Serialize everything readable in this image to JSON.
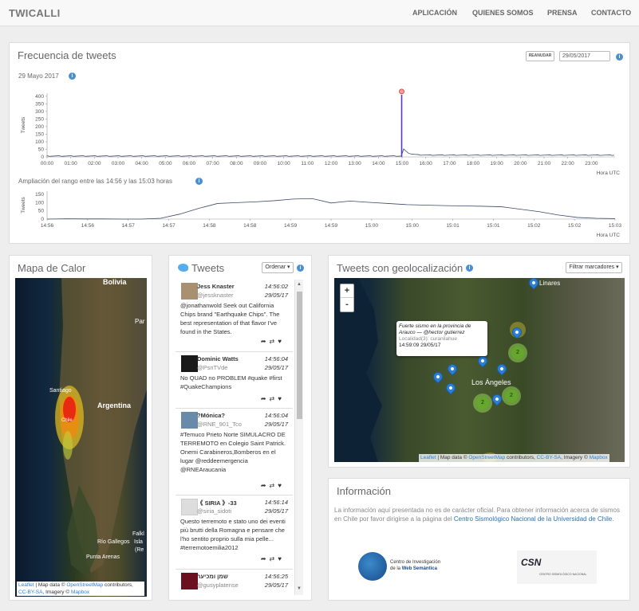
{
  "brand": "TWICALLI",
  "nav": [
    "APLICACIÓN",
    "QUIENES SOMOS",
    "PRENSA",
    "CONTACTO"
  ],
  "freq": {
    "title": "Frecuencia de tweets",
    "resume_button": "REANUDAR",
    "date_input": "29/05/2017",
    "date_label": "29 Mayo 2017",
    "range_label": "Ampliación del rango entre las 14:56 y las 15:03 horas",
    "axis_unit": "Hora UTC",
    "y_label": "Tweets"
  },
  "chart_data": [
    {
      "type": "line",
      "title": "Frecuencia de tweets",
      "ylabel": "Tweets",
      "xlabel": "Hora UTC",
      "yticks": [
        0,
        50,
        100,
        150,
        200,
        250,
        300,
        350,
        400
      ],
      "ylim": [
        0,
        420
      ],
      "xticks": [
        "00:00",
        "01:00",
        "02:00",
        "03:00",
        "04:00",
        "05:00",
        "06:00",
        "07:00",
        "08:00",
        "09:00",
        "10:00",
        "11:00",
        "12:00",
        "13:00",
        "14:00",
        "15:00",
        "16:00",
        "17:00",
        "18:00",
        "19:00",
        "20:00",
        "21:00",
        "22:00",
        "23:00"
      ],
      "peak": {
        "x": "14:59",
        "y": 410
      }
    },
    {
      "type": "line",
      "title": "Ampliación del rango entre las 14:56 y las 15:03 horas",
      "ylabel": "Tweets",
      "xlabel": "Hora UTC",
      "yticks": [
        0,
        50,
        100,
        150
      ],
      "ylim": [
        0,
        170
      ],
      "xticks": [
        "14:56",
        "14:56",
        "14:57",
        "14:57",
        "14:58",
        "14:58",
        "14:59",
        "14:59",
        "15:00",
        "15:00",
        "15:01",
        "15:01",
        "15:02",
        "15:02",
        "15:03"
      ],
      "values": [
        0,
        2,
        1,
        1,
        0,
        0,
        5,
        30,
        65,
        95,
        100,
        105,
        112,
        122,
        125,
        98,
        110,
        102,
        95,
        88,
        85,
        82,
        80,
        78,
        75,
        60,
        45,
        25,
        10,
        5,
        3
      ]
    }
  ],
  "heat": {
    "title": "Mapa de Calor",
    "labels": [
      "Bolivia",
      "Par",
      "Santiago",
      "Argentina",
      "Chile",
      "Falkl",
      "Isla",
      "(Re",
      "Río Gallegos",
      "Punta Arenas"
    ],
    "attr": {
      "leaflet": "Leaflet",
      "a": " | Map data © ",
      "osm": "OpenStreetMap",
      "b": " contributors, ",
      "cc": "CC-BY-SA",
      "c": ", Imagery © ",
      "mb": "Mapbox"
    }
  },
  "tweets": {
    "title": "Tweets",
    "order_button": "Ordenar ▾",
    "items": [
      {
        "name": "Jess Knaster",
        "handle": "@jessknaster",
        "time": "14:56:02",
        "date": "29/05/17",
        "text": "@jonathanwold Seek out California Chips brand \"Earthquake Chips\". The best representation of that flavor I've found in the States."
      },
      {
        "name": "Dominic Watts",
        "handle": "@PsnTVde",
        "time": "14:56:04",
        "date": "29/05/17",
        "text": "No QUAD no PROBLEM #quake #first #QuakeChampions"
      },
      {
        "name": "?Mónica?",
        "handle": "@RNE_901_Tco",
        "time": "14:56:04",
        "date": "29/05/17",
        "text": "#Temuco Prieto Norte SIMULACRO DE TERREMOTO en Colegio Saint Patrick. Onemi Carabineros,Bomberos en el lugar @reddeemergencia @RNEAraucania"
      },
      {
        "name": "《 SIRIA 》-33",
        "handle": "@siria_sidoti",
        "time": "14:56:14",
        "date": "29/05/17",
        "text": "Questo terremoto e stato uno dei eventi più brutti della Romagna e pensare che l'ho sentito proprio sulla mia pelle... #terremotoemilia2012"
      },
      {
        "name": "שמן ומכיער",
        "handle": "@gusyplatense",
        "time": "14:56:25",
        "date": "29/05/17",
        "text": ""
      }
    ]
  },
  "geo": {
    "title": "Tweets con geolocalización",
    "filter_button": "Filtrar marcadores ▾",
    "zoom_in": "+",
    "zoom_out": "-",
    "popup": {
      "title": "Fuerte sismo en la provincia de Arauco — @hector gutierrez",
      "loc": "Localidad(3): curanilahue",
      "time": "14:59:09 29/05/17"
    },
    "places": [
      "Linares",
      "Los Ángeles"
    ],
    "clusters": [
      "2",
      "2",
      "2"
    ]
  },
  "infopanel": {
    "title": "Información",
    "text": "La información aquí presentada no es de carácter oficial. Para obtener información acerca de sismos en Chile por favor dirigirse a la página del ",
    "link": "Centro Sismológico Nacional de la Universidad de Chile",
    "end": ".",
    "logo1a": "Centro de Investigación",
    "logo1b": "de la ",
    "logo1c": "Web Semántica",
    "logo2": "CSN",
    "logo2b": "CENTRO SISMOLÓGICO NACIONAL"
  }
}
